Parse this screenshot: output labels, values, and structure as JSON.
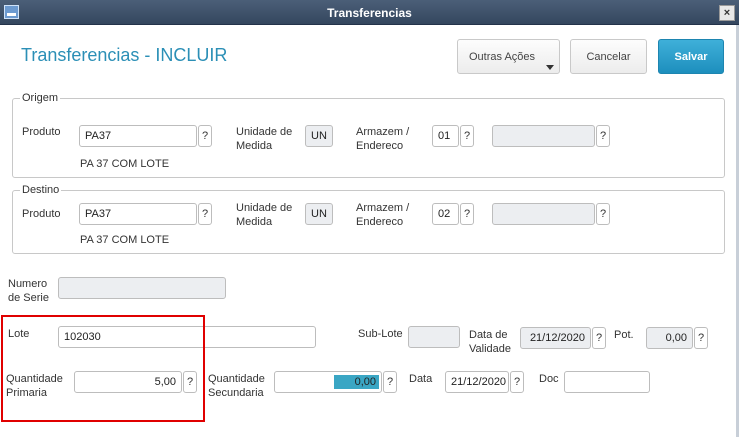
{
  "window": {
    "title": "Transferencias"
  },
  "page": {
    "title": "Transferencias - INCLUIR"
  },
  "toolbar": {
    "outras": "Outras Ações",
    "cancelar": "Cancelar",
    "salvar": "Salvar"
  },
  "origem": {
    "legend": "Origem",
    "produto_label": "Produto",
    "produto": "PA37",
    "unidade_label_1": "Unidade de",
    "unidade_label_2": "Medida",
    "unidade": "UN",
    "armazem_label_1": "Armazem  /",
    "armazem_label_2": "Endereco",
    "armazem": "01",
    "endereco": "",
    "descricao": "PA 37 COM LOTE"
  },
  "destino": {
    "legend": "Destino",
    "produto_label": "Produto",
    "produto": "PA37",
    "unidade_label_1": "Unidade de",
    "unidade_label_2": "Medida",
    "unidade": "UN",
    "armazem_label_1": "Armazem  /",
    "armazem_label_2": "Endereco",
    "armazem": "02",
    "endereco": "",
    "descricao": "PA 37 COM LOTE"
  },
  "serie": {
    "label_1": "Numero",
    "label_2": "de Serie",
    "value": ""
  },
  "lote": {
    "label": "Lote",
    "value": "102030",
    "sublote_label": "Sub-Lote",
    "sublote": "",
    "validade_label_1": "Data de",
    "validade_label_2": "Validade",
    "validade": "21/12/2020",
    "pot_label": "Pot.",
    "pot": "0,00"
  },
  "quantidade": {
    "prim_label_1": "Quantidade",
    "prim_label_2": "Primaria",
    "primaria": "5,00",
    "sec_label_1": "Quantidade",
    "sec_label_2": "Secundaria",
    "secundaria": "0,00",
    "data_label": "Data",
    "data": "21/12/2020",
    "doc_label": "Doc",
    "doc": ""
  },
  "help_glyph": "?",
  "close_glyph": "×",
  "icons": {
    "app": "window-app-icon",
    "close": "close-icon",
    "caret": "caret-down-icon"
  },
  "colors": {
    "accent": "#2b8fb6",
    "salvar": "#1d8fbd",
    "highlight": "#e00000"
  }
}
